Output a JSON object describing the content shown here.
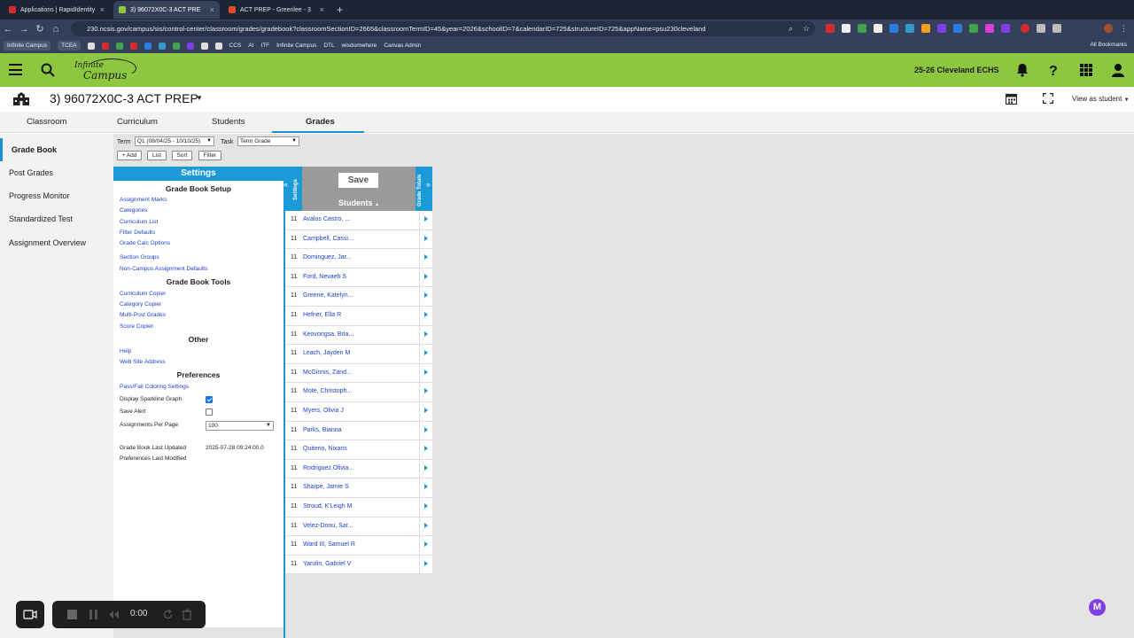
{
  "browser": {
    "tabs": [
      {
        "title": "Applications | RapidIdentity",
        "active": false
      },
      {
        "title": "3) 96072X0C-3 ACT PRE",
        "active": true
      },
      {
        "title": "ACT PREP - Greenlee - 3",
        "active": false
      }
    ],
    "new_tab": "+",
    "url": "230.ncsis.gov/campus/sis/control-center/classroom/grades/gradebook?classroomSectionID=2665&classroomTermID=45&year=2026&schoolID=7&calendarID=725&structureID=725&appName=psu230cleveland",
    "bookmarks": [
      "Infinite Campus",
      "TCEA",
      "CCS",
      "AI",
      "ITF",
      "Infinite Campus",
      "DTL",
      "wisdomwhere",
      "Canvas Admin"
    ],
    "all_bookmarks": "All Bookmarks"
  },
  "header": {
    "logo_line1": "Infinite",
    "logo_line2": "Campus",
    "school": "25-26 Cleveland ECHS",
    "accent": "#8dc63f"
  },
  "section": {
    "title": "3) 96072X0C-3 ACT PREP",
    "view_as": "View as student"
  },
  "nav_tabs": [
    {
      "label": "Classroom",
      "active": false
    },
    {
      "label": "Curriculum",
      "active": false
    },
    {
      "label": "Students",
      "active": false
    },
    {
      "label": "Grades",
      "active": true
    }
  ],
  "left_nav": [
    {
      "label": "Grade Book",
      "active": true
    },
    {
      "label": "Post Grades",
      "active": false
    },
    {
      "label": "Progress Monitor",
      "active": false
    },
    {
      "label": "Standardized Test",
      "active": false
    },
    {
      "label": "Assignment Overview",
      "active": false
    }
  ],
  "filters": {
    "term_label": "Term",
    "term_value": "Q1 (08/04/25 - 10/10/25)",
    "task_label": "Task",
    "task_value": "Term Grade",
    "buttons": [
      "+ Add",
      "List",
      "Sort",
      "Filter"
    ]
  },
  "settings": {
    "title": "Settings",
    "setup_heading": "Grade Book Setup",
    "setup_links": [
      "Assignment Marks",
      "Categories",
      "Curriculum List",
      "Filter Defaults",
      "Grade Calc Options"
    ],
    "setup_links2": [
      "Section Groups",
      "Non-Campus Assignment Defaults"
    ],
    "tools_heading": "Grade Book Tools",
    "tools_links": [
      "Curriculum Copier",
      "Category Copier",
      "Multi-Post Grades",
      "Score Copier"
    ],
    "other_heading": "Other",
    "other_links": [
      "Help",
      "Web Site Address"
    ],
    "prefs_heading": "Preferences",
    "prefs_link": "Pass/Fail Coloring Settings",
    "sparkline_label": "Display Sparkline Graph",
    "sparkline_checked": true,
    "save_alert_label": "Save Alert",
    "save_alert_checked": false,
    "per_page_label": "Assignments Per Page",
    "per_page_value": "100",
    "last_updated_label": "Grade Book Last Updated",
    "last_updated_value": "2025-07-28 09:24:00.0",
    "prefs_modified_label": "Preferences Last Modified"
  },
  "grid": {
    "left_strip": "Settings",
    "right_strip": "Grade Totals",
    "save": "Save",
    "students_header": "Students",
    "sort_indicator": "▲",
    "rows": [
      {
        "grade": "11",
        "name": "Avalos Castro, ..."
      },
      {
        "grade": "11",
        "name": "Campbell, Cassi..."
      },
      {
        "grade": "11",
        "name": "Dominguez, Jar..."
      },
      {
        "grade": "11",
        "name": "Ford, Nevaeh S"
      },
      {
        "grade": "11",
        "name": "Greene, Katelyn..."
      },
      {
        "grade": "11",
        "name": "Hefner, Ella R"
      },
      {
        "grade": "11",
        "name": "Keovongsa, Bria..."
      },
      {
        "grade": "11",
        "name": "Leach, Jayden M"
      },
      {
        "grade": "11",
        "name": "McGinnis, Zand..."
      },
      {
        "grade": "11",
        "name": "Mote, Christoph..."
      },
      {
        "grade": "11",
        "name": "Myers, Olivia J"
      },
      {
        "grade": "11",
        "name": "Parks, Bianna"
      },
      {
        "grade": "11",
        "name": "Quiterio, Nixaris"
      },
      {
        "grade": "11",
        "name": "Rodriguez Olivia..."
      },
      {
        "grade": "11",
        "name": "Sharpe, Jamie S"
      },
      {
        "grade": "11",
        "name": "Stroud, K'Leigh M"
      },
      {
        "grade": "11",
        "name": "Velez-Donu, Sar..."
      },
      {
        "grade": "11",
        "name": "Ward III, Samuel R"
      },
      {
        "grade": "11",
        "name": "Yarulin, Gabriel V"
      }
    ]
  },
  "recorder": {
    "time": "0:00"
  },
  "assistant_badge": "M"
}
